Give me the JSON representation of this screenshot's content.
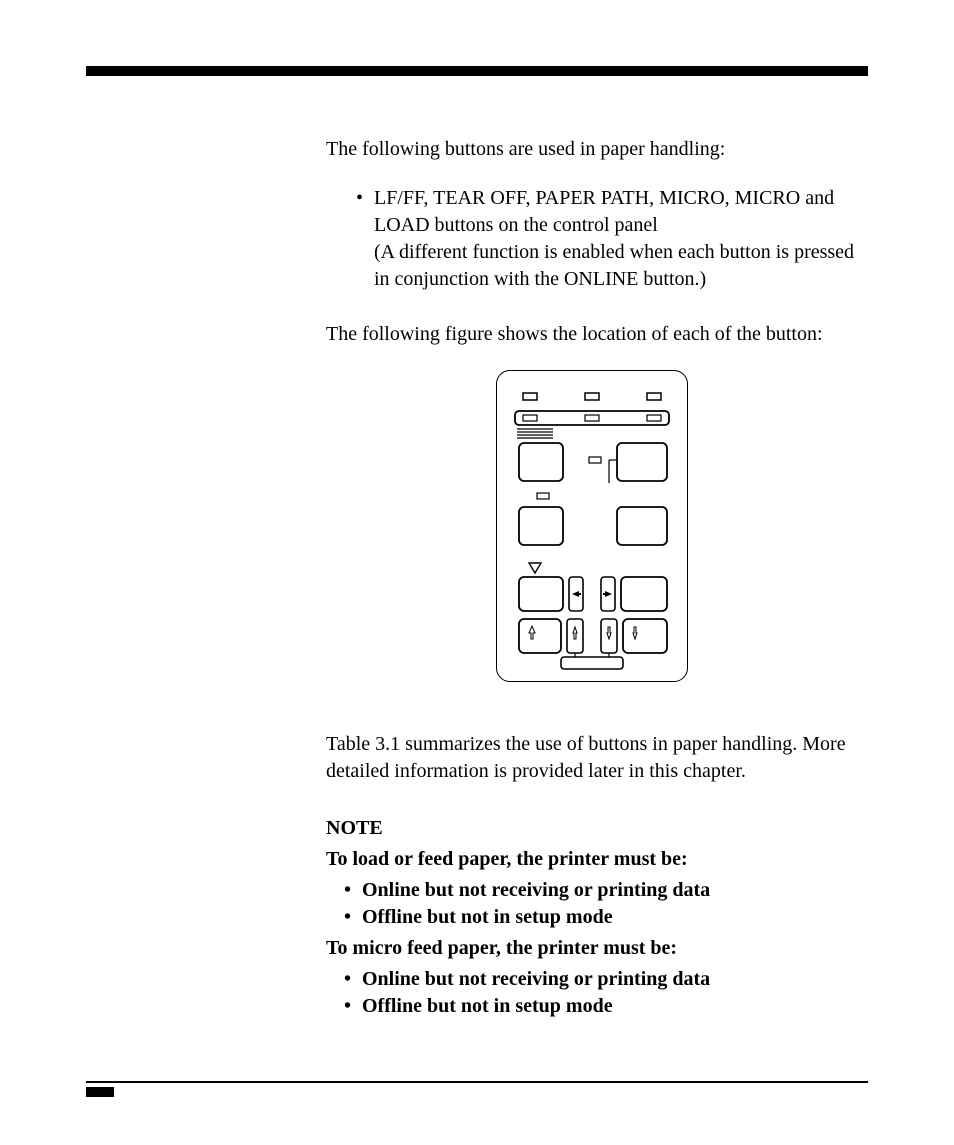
{
  "p1": "The following buttons are used in paper handling:",
  "bullet1": "LF/FF, TEAR OFF, PAPER PATH,   MICRO,   MICRO and LOAD buttons on the control panel",
  "bullet1b": "(A different function is enabled when each button is pressed in conjunction with the ONLINE button.)",
  "p2": "The following figure shows the location of each of the button:",
  "p3": "Table 3.1 summarizes the use of buttons in paper handling.  More detailed information is provided later in this chapter.",
  "note": {
    "heading": "NOTE",
    "l1": "To load or feed paper, the printer must be:",
    "i1": "Online but not receiving or printing data",
    "i2": "Offline but not in setup mode",
    "l2": "To micro feed paper, the printer must be:",
    "i3": "Online but not receiving or printing data",
    "i4": "Offline but not in setup mode"
  }
}
